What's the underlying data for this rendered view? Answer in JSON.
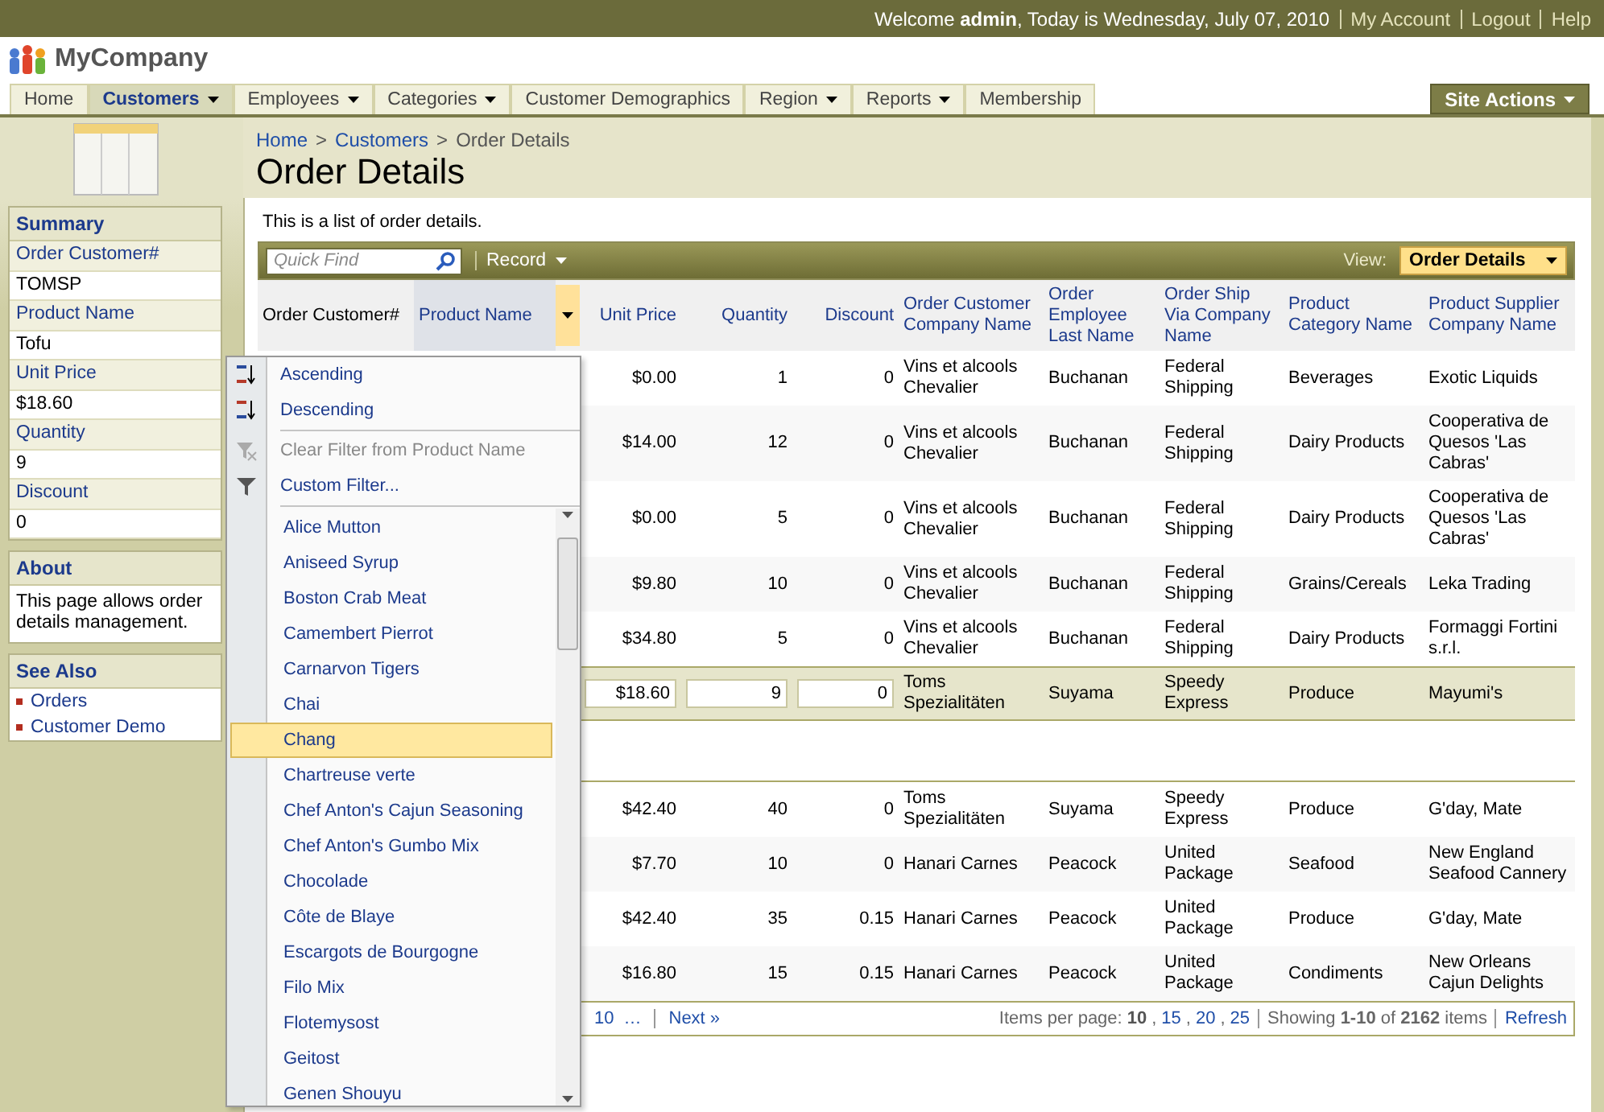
{
  "top_bar": {
    "welcome": "Welcome **admin**, Today is Wednesday, July 07, 2010",
    "links": [
      "My Account",
      "Logout",
      "Help"
    ]
  },
  "logo": "MyCompany",
  "nav": {
    "items": [
      {
        "label": "Home",
        "has_menu": false,
        "selected": false
      },
      {
        "label": "Customers",
        "has_menu": true,
        "selected": true
      },
      {
        "label": "Employees",
        "has_menu": true,
        "selected": false
      },
      {
        "label": "Categories",
        "has_menu": true,
        "selected": false
      },
      {
        "label": "Customer Demographics",
        "has_menu": false,
        "selected": false
      },
      {
        "label": "Region",
        "has_menu": true,
        "selected": false
      },
      {
        "label": "Reports",
        "has_menu": true,
        "selected": false
      },
      {
        "label": "Membership",
        "has_menu": false,
        "selected": false
      }
    ],
    "site_actions": "Site Actions"
  },
  "breadcrumb": {
    "items": [
      "Home",
      "Customers",
      "Order Details"
    ],
    "separator": ">"
  },
  "title": "Order Details",
  "sidebar": {
    "summary": {
      "title": "Summary",
      "fields": [
        {
          "label": "Order Customer#",
          "value": "TOMSP"
        },
        {
          "label": "Product Name",
          "value": "Tofu"
        },
        {
          "label": "Unit Price",
          "value": "$18.60"
        },
        {
          "label": "Quantity",
          "value": "9"
        },
        {
          "label": "Discount",
          "value": "0"
        }
      ]
    },
    "about": {
      "title": "About",
      "text": "This page allows order details management."
    },
    "see_also": {
      "title": "See Also",
      "links": [
        "Orders",
        "Customer Demo"
      ]
    }
  },
  "description": "This is a list of order details.",
  "toolbar": {
    "quick_find": {
      "placeholder": "Quick Find"
    },
    "record_menu": "Record",
    "view_label": "View:",
    "view_value": "Order Details"
  },
  "table": {
    "columns": [
      {
        "label": "Order Customer#",
        "kind": "text"
      },
      {
        "label": "Product Name",
        "kind": "text"
      },
      {
        "label": "Unit Price",
        "kind": "number"
      },
      {
        "label": "Quantity",
        "kind": "number"
      },
      {
        "label": "Discount",
        "kind": "number"
      },
      {
        "label": "Order Customer Company Name",
        "kind": "text"
      },
      {
        "label": "Order Employee Last Name",
        "kind": "text"
      },
      {
        "label": "Order Ship Via Company Name",
        "kind": "text"
      },
      {
        "label": "Product Category Name",
        "kind": "text"
      },
      {
        "label": "Product Supplier Company Name",
        "kind": "text"
      }
    ],
    "rows": [
      {
        "kind": "data",
        "cells": [
          "",
          "",
          "$0.00",
          "1",
          "0",
          "Vins et alcools Chevalier",
          "Buchanan",
          "Federal Shipping",
          "Beverages",
          "Exotic Liquids"
        ]
      },
      {
        "kind": "data",
        "cells": [
          "",
          "",
          "$14.00",
          "12",
          "0",
          "Vins et alcools Chevalier",
          "Buchanan",
          "Federal Shipping",
          "Dairy Products",
          "Cooperativa de Quesos 'Las Cabras'"
        ]
      },
      {
        "kind": "data",
        "cells": [
          "",
          "",
          "$0.00",
          "5",
          "0",
          "Vins et alcools Chevalier",
          "Buchanan",
          "Federal Shipping",
          "Dairy Products",
          "Cooperativa de Quesos 'Las Cabras'"
        ]
      },
      {
        "kind": "data",
        "cells": [
          "",
          "",
          "$9.80",
          "10",
          "0",
          "Vins et alcools Chevalier",
          "Buchanan",
          "Federal Shipping",
          "Grains/Cereals",
          "Leka Trading"
        ]
      },
      {
        "kind": "data",
        "cells": [
          "",
          "",
          "$34.80",
          "5",
          "0",
          "Vins et alcools Chevalier",
          "Buchanan",
          "Federal Shipping",
          "Dairy Products",
          "Formaggi Fortini s.r.l."
        ]
      },
      {
        "kind": "edit",
        "cells": [
          "",
          "",
          "$18.60",
          "9",
          "0",
          "Toms Spezialitäten",
          "Suyama",
          "Speedy Express",
          "Produce",
          "Mayumi's"
        ]
      },
      {
        "kind": "data",
        "cells": [
          "",
          "",
          "$42.40",
          "40",
          "0",
          "Toms Spezialitäten",
          "Suyama",
          "Speedy Express",
          "Produce",
          "G'day, Mate"
        ]
      },
      {
        "kind": "data",
        "cells": [
          "",
          "",
          "$7.70",
          "10",
          "0",
          "Hanari Carnes",
          "Peacock",
          "United Package",
          "Seafood",
          "New England Seafood Cannery"
        ]
      },
      {
        "kind": "data",
        "cells": [
          "",
          "",
          "$42.40",
          "35",
          "0.15",
          "Hanari Carnes",
          "Peacock",
          "United Package",
          "Produce",
          "G'day, Mate"
        ]
      },
      {
        "kind": "data",
        "cells": [
          "",
          "",
          "$16.80",
          "15",
          "0.15",
          "Hanari Carnes",
          "Peacock",
          "United Package",
          "Condiments",
          "New Orleans Cajun Delights"
        ]
      }
    ]
  },
  "column_menu": {
    "actions": [
      {
        "kind": "ascending",
        "label": "Ascending",
        "disabled": false
      },
      {
        "kind": "descending",
        "label": "Descending",
        "disabled": false
      },
      {
        "kind": "clear",
        "label": "Clear Filter from Product Name",
        "disabled": true
      },
      {
        "kind": "filter",
        "label": "Custom Filter...",
        "disabled": false
      }
    ],
    "values": [
      {
        "label": "Alice Mutton",
        "selected": false
      },
      {
        "label": "Aniseed Syrup",
        "selected": false
      },
      {
        "label": "Boston Crab Meat",
        "selected": false
      },
      {
        "label": "Camembert Pierrot",
        "selected": false
      },
      {
        "label": "Carnarvon Tigers",
        "selected": false
      },
      {
        "label": "Chai",
        "selected": false
      },
      {
        "label": "Chang",
        "selected": true
      },
      {
        "label": "Chartreuse verte",
        "selected": false
      },
      {
        "label": "Chef Anton's Cajun Seasoning",
        "selected": false
      },
      {
        "label": "Chef Anton's Gumbo Mix",
        "selected": false
      },
      {
        "label": "Chocolade",
        "selected": false
      },
      {
        "label": "Côte de Blaye",
        "selected": false
      },
      {
        "label": "Escargots de Bourgogne",
        "selected": false
      },
      {
        "label": "Filo Mix",
        "selected": false
      },
      {
        "label": "Flotemysost",
        "selected": false
      },
      {
        "label": "Geitost",
        "selected": false
      },
      {
        "label": "Genen Shouyu",
        "selected": false
      }
    ]
  },
  "pager": {
    "pages": [
      "10",
      "…"
    ],
    "next": "Next »",
    "items_per_page_label": "Items per page:",
    "page_sizes": [
      {
        "label": "10",
        "selected": true
      },
      {
        "label": "15",
        "selected": false
      },
      {
        "label": "20",
        "selected": false
      },
      {
        "label": "25",
        "selected": false
      }
    ],
    "size_separator": ",",
    "showing": "Showing **1-10** of **2162** items",
    "refresh": "Refresh"
  }
}
